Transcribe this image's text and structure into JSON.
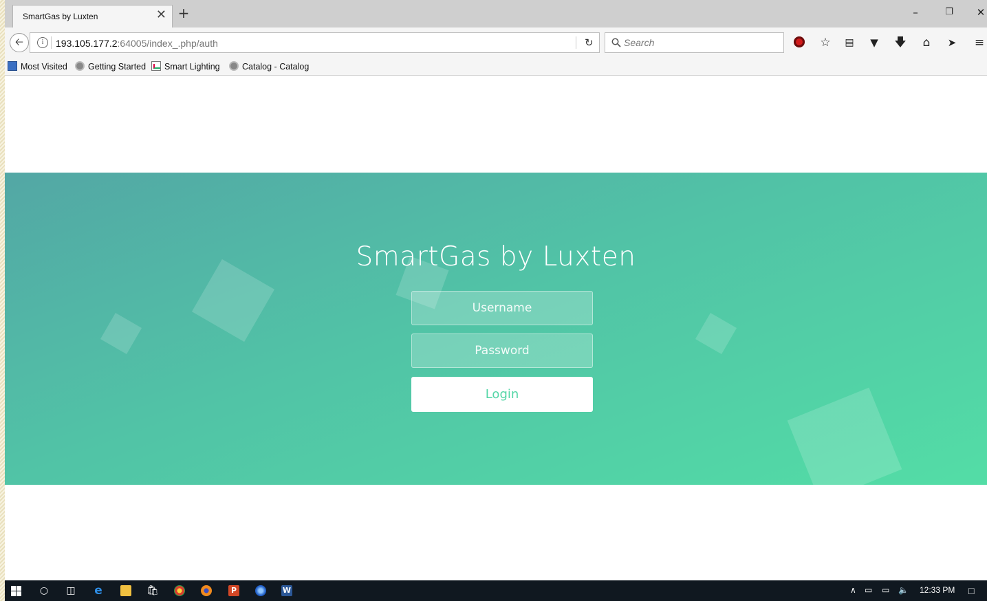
{
  "browser": {
    "tab": {
      "title": "SmartGas by Luxten",
      "close_glyph": "✕",
      "new_tab_glyph": "+"
    },
    "window_controls": {
      "minimize": "–",
      "restore": "❐",
      "close": "✕"
    },
    "url": {
      "host": "193.105.177.2",
      "rest": ":64005/index_.php/auth"
    },
    "search": {
      "placeholder": "Search"
    },
    "toolbar_icons": [
      "record-icon",
      "bookmark-star-icon",
      "reader-icon",
      "pocket-icon",
      "download-icon",
      "home-icon",
      "send-icon",
      "menu-icon"
    ],
    "bookmarks": [
      {
        "label": "Most Visited",
        "icon": "most-visited-icon"
      },
      {
        "label": "Getting Started",
        "icon": "globe-icon"
      },
      {
        "label": "Smart Lighting",
        "icon": "chart-icon"
      },
      {
        "label": "Catalog - Catalog",
        "icon": "globe-icon"
      }
    ]
  },
  "page": {
    "title": "SmartGas by Luxten",
    "username": {
      "placeholder": "Username",
      "value": ""
    },
    "password": {
      "placeholder": "Password",
      "value": ""
    },
    "login_label": "Login",
    "colors": {
      "gradient_start": "#53a7a5",
      "gradient_end": "#53dda6",
      "button_text": "#53d6a6"
    }
  },
  "taskbar": {
    "apps": [
      "start-icon",
      "cortana-icon",
      "task-view-icon",
      "edge-icon",
      "file-explorer-icon",
      "store-icon",
      "chrome-icon",
      "firefox-icon",
      "powerpoint-icon",
      "app-icon",
      "word-icon"
    ],
    "clock": "12:33 PM"
  }
}
